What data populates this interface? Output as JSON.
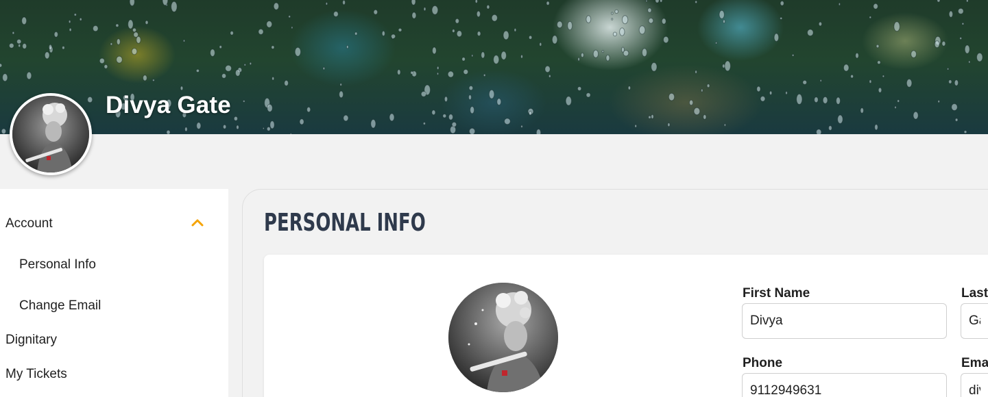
{
  "profile": {
    "name": "Divya Gate"
  },
  "sidebar": {
    "items": [
      {
        "label": "Account"
      },
      {
        "label": "Personal Info"
      },
      {
        "label": "Change Email"
      },
      {
        "label": "Dignitary"
      },
      {
        "label": "My Tickets"
      }
    ],
    "expanded_icon": "chevron-up-icon"
  },
  "main": {
    "title": "PERSONAL INFO",
    "fields": {
      "first_name": {
        "label": "First Name",
        "value": "Divya"
      },
      "last_name": {
        "label": "Last",
        "value": "Gat"
      },
      "phone": {
        "label": "Phone",
        "value": "9112949631"
      },
      "email": {
        "label": "Ema",
        "value": "div"
      }
    }
  },
  "colors": {
    "accent": "#f5a300",
    "title": "#2f3a4c",
    "sidebar_bg": "#ffffff",
    "page_bg": "#f2f2f2"
  }
}
